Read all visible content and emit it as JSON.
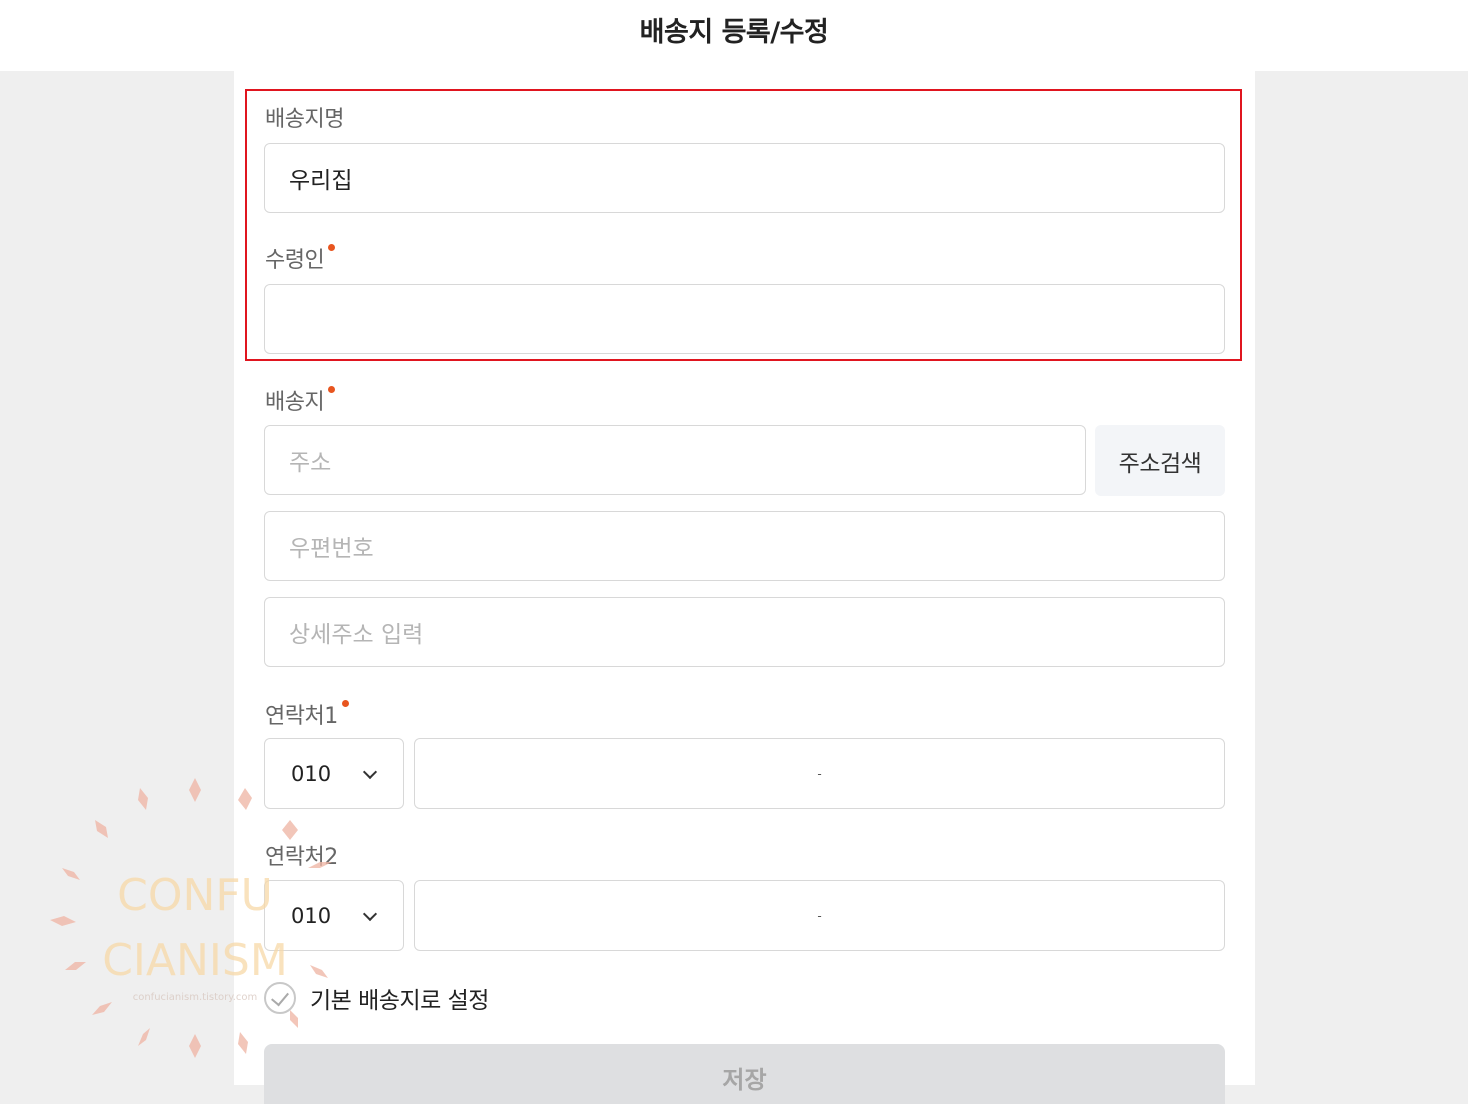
{
  "page": {
    "title": "배송지 등록/수정"
  },
  "form": {
    "address_name": {
      "label": "배송지명",
      "value": "우리집"
    },
    "recipient": {
      "label": "수령인",
      "value": "",
      "required": true
    },
    "address": {
      "label": "배송지",
      "required": true,
      "address_placeholder": "주소",
      "search_button": "주소검색",
      "zip_placeholder": "우편번호",
      "detail_placeholder": "상세주소 입력"
    },
    "phone1": {
      "label": "연락처1",
      "required": true,
      "prefix": "010",
      "separator": "-"
    },
    "phone2": {
      "label": "연락처2",
      "prefix": "010",
      "separator": "-"
    },
    "default_checkbox": {
      "label": "기본 배송지로 설정",
      "checked": false
    },
    "save_button": "저장"
  },
  "watermark": {
    "line1": "CONFU",
    "line2": "CIANISM",
    "line3": "confucianism.tistory.com"
  },
  "colors": {
    "highlight": "#e0151f",
    "required_dot": "#e8551f"
  }
}
